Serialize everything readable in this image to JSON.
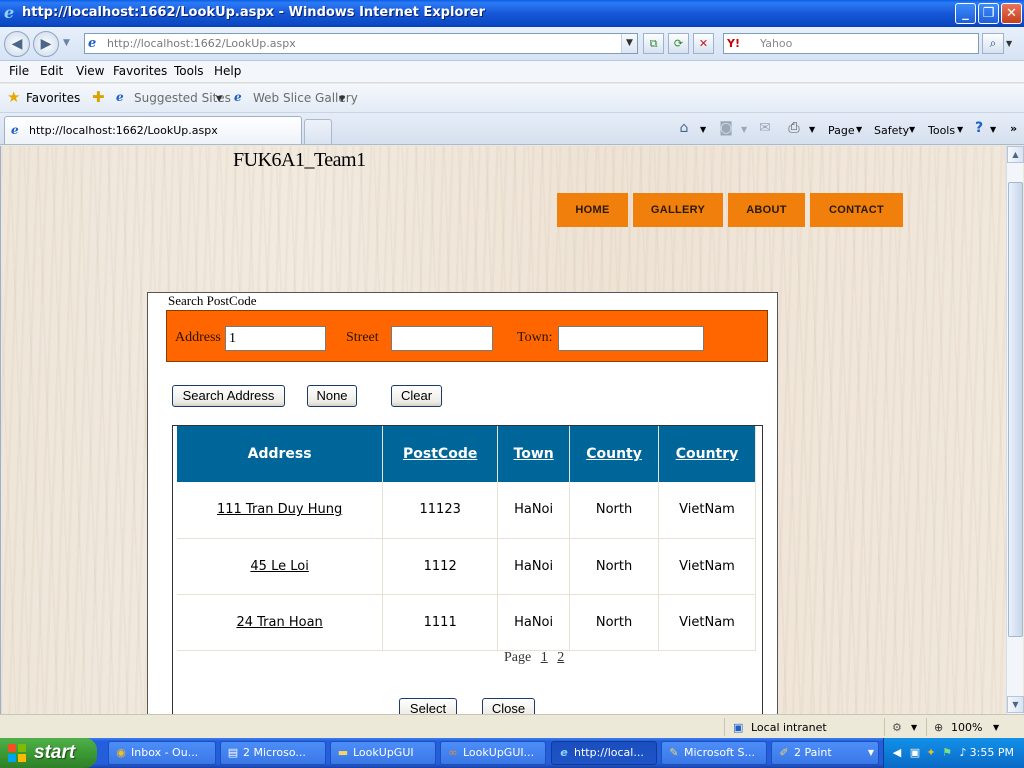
{
  "window": {
    "title": "http://localhost:1662/LookUp.aspx - Windows Internet Explorer",
    "minimize": "_",
    "maximize": "❐",
    "close": "✕"
  },
  "address_bar": {
    "url": "http://localhost:1662/LookUp.aspx",
    "search_placeholder": "Yahoo",
    "search_provider_icon": "Y!"
  },
  "menu": {
    "items": [
      "File",
      "Edit",
      "View",
      "Favorites",
      "Tools",
      "Help"
    ]
  },
  "favorites_bar": {
    "favorites_label": "Favorites",
    "suggested_sites": "Suggested Sites",
    "web_slice_gallery": "Web Slice Gallery"
  },
  "tab": {
    "label": "http://localhost:1662/LookUp.aspx"
  },
  "command_bar": {
    "page": "Page",
    "safety": "Safety",
    "tools": "Tools"
  },
  "site": {
    "name": "FUK6A1_Team1",
    "nav": [
      "HOME",
      "GALLERY",
      "ABOUT",
      "CONTACT"
    ]
  },
  "search_panel": {
    "legend": "Search PostCode",
    "address_label": "Address",
    "address_value": "1",
    "street_label": "Street",
    "street_value": "",
    "town_label": "Town:",
    "town_value": ""
  },
  "buttons": {
    "search_address": "Search Address",
    "none": "None",
    "clear": "Clear",
    "select": "Select",
    "close": "Close"
  },
  "results": {
    "columns": [
      "Address",
      "PostCode",
      "Town",
      "County",
      "Country"
    ],
    "rows": [
      [
        "111 Tran Duy Hung",
        "11123",
        "HaNoi",
        "North",
        "VietNam"
      ],
      [
        "45 Le Loi",
        "1112",
        "HaNoi",
        "North",
        "VietNam"
      ],
      [
        "24 Tran Hoan",
        "1111",
        "HaNoi",
        "North",
        "VietNam"
      ]
    ],
    "pager_label": "Page",
    "pages": [
      "1",
      "2"
    ]
  },
  "status_bar": {
    "zone": "Local intranet",
    "zoom": "100%"
  },
  "taskbar": {
    "start": "start",
    "tasks": [
      "Inbox - Ou...",
      "2 Microso...",
      "LookUpGUI",
      "LookUpGUI...",
      "http://local...",
      "Microsoft S...",
      "2 Paint"
    ],
    "clock": "3:55 PM"
  },
  "colors": {
    "nav_orange": "#F07F0C",
    "search_orange": "#FF6600",
    "grid_header": "#006699",
    "taskbar_blue": "#245EDB"
  }
}
